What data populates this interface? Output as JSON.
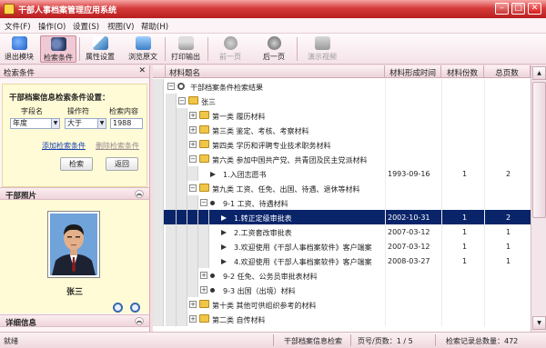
{
  "window": {
    "title": "干部人事档案管理应用系统",
    "min": "–",
    "max": "□",
    "close": "✕"
  },
  "menu": [
    "文件(F)",
    "操作(O)",
    "设置(S)",
    "视图(V)",
    "帮助(H)"
  ],
  "toolbar": [
    "退出模块",
    "检索条件",
    "属性设置",
    "浏览原文",
    "打印输出",
    "前一页",
    "后一页",
    "演示视频"
  ],
  "left_panel": {
    "header": "检索条件",
    "close_glyph": "✕",
    "search_title": "干部档案信息检索条件设置：",
    "col_field": "字段名",
    "col_operator": "操作符",
    "col_content": "检索内容",
    "field_value": "年度",
    "operator_value": "大于",
    "content_value": "1988",
    "add_condition": "添加检索条件",
    "delete_condition": "删除检索条件",
    "search_button": "检索",
    "back_button": "返回",
    "photo_section": "干部照片",
    "person_name": "张三",
    "detail_section": "详细信息",
    "collapse_glyph": "︽"
  },
  "table": {
    "headers": [
      "材料题名",
      "材料形成时间",
      "材料份数",
      "总页数"
    ],
    "rows": [
      {
        "level": 0,
        "expander": "−",
        "icon": "search",
        "title": "干部档案条件检索结果",
        "date": "",
        "copies": "",
        "pages": ""
      },
      {
        "level": 1,
        "expander": "−",
        "icon": "folder",
        "title": "张三",
        "date": "",
        "copies": "",
        "pages": ""
      },
      {
        "level": 2,
        "expander": "+",
        "icon": "folder",
        "title": "第一类 履历材料",
        "date": "",
        "copies": "",
        "pages": ""
      },
      {
        "level": 2,
        "expander": "+",
        "icon": "folder",
        "title": "第三类 鉴定、考核、考察材料",
        "date": "",
        "copies": "",
        "pages": ""
      },
      {
        "level": 2,
        "expander": "+",
        "icon": "folder",
        "title": "第四类 学历和评聘专业技术职务材料",
        "date": "",
        "copies": "",
        "pages": ""
      },
      {
        "level": 2,
        "expander": "−",
        "icon": "folder",
        "title": "第六类 参加中国共产党、共青团及民主党派材料",
        "date": "",
        "copies": "",
        "pages": ""
      },
      {
        "level": 3,
        "expander": "",
        "icon": "leaf",
        "title": "1.入团志愿书",
        "date": "1993-09-16",
        "copies": "1",
        "pages": "2"
      },
      {
        "level": 2,
        "expander": "−",
        "icon": "folder",
        "title": "第九类 工资、任免、出国、待遇、退休等材料",
        "date": "",
        "copies": "",
        "pages": ""
      },
      {
        "level": 3,
        "expander": "−",
        "icon": "dot",
        "title": "9-1 工资、待遇材料",
        "date": "",
        "copies": "",
        "pages": ""
      },
      {
        "level": 4,
        "expander": "",
        "icon": "leaf",
        "title": "1.转正定级审批表",
        "date": "2002-10-31",
        "copies": "1",
        "pages": "2",
        "selected": true
      },
      {
        "level": 4,
        "expander": "",
        "icon": "leaf",
        "title": "2.工资套改审批表",
        "date": "2007-03-12",
        "copies": "1",
        "pages": "1"
      },
      {
        "level": 4,
        "expander": "",
        "icon": "leaf",
        "title": "3.欢迎使用《干部人事档案软件》客户端案",
        "date": "2007-03-12",
        "copies": "1",
        "pages": "1"
      },
      {
        "level": 4,
        "expander": "",
        "icon": "leaf",
        "title": "4.欢迎使用《干部人事档案软件》客户端案",
        "date": "2008-03-27",
        "copies": "1",
        "pages": "1"
      },
      {
        "level": 3,
        "expander": "+",
        "icon": "dot",
        "title": "9-2 任免、公务员审批表材料",
        "date": "",
        "copies": "",
        "pages": ""
      },
      {
        "level": 3,
        "expander": "+",
        "icon": "dot",
        "title": "9-3 出国（出境）材料",
        "date": "",
        "copies": "",
        "pages": ""
      },
      {
        "level": 2,
        "expander": "+",
        "icon": "folder",
        "title": "第十类 其他可供组织参考的材料",
        "date": "",
        "copies": "",
        "pages": ""
      },
      {
        "level": 2,
        "expander": "+",
        "icon": "folder",
        "title": "第二类 自传材料",
        "date": "",
        "copies": "",
        "pages": ""
      }
    ]
  },
  "status": {
    "ready": "就绪",
    "mode": "干部档案信息检索",
    "page_info": "页号/页数：1 / 5",
    "record_count": "检索记录总数量：472"
  }
}
